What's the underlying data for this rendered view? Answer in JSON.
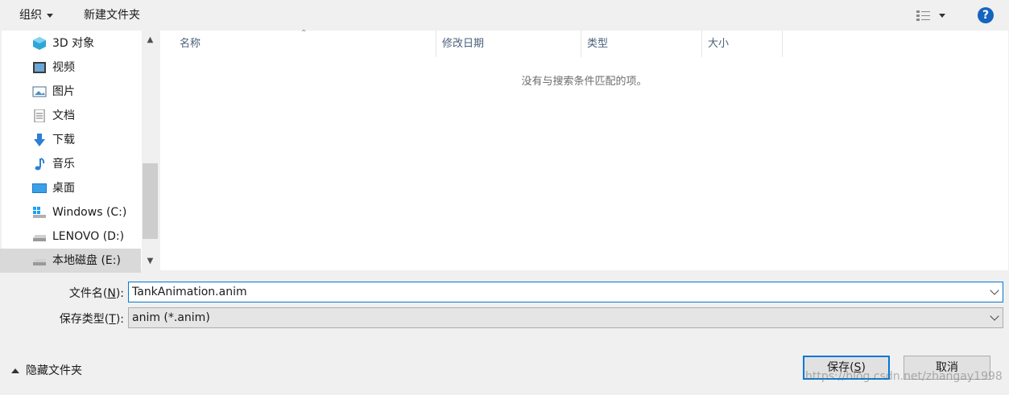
{
  "toolbar": {
    "organize_label": "组织",
    "new_folder_label": "新建文件夹",
    "help_label": "?"
  },
  "nav": {
    "items": [
      {
        "label": "3D 对象",
        "icon": "3d-objects-icon"
      },
      {
        "label": "视频",
        "icon": "video-icon"
      },
      {
        "label": "图片",
        "icon": "picture-icon"
      },
      {
        "label": "文档",
        "icon": "document-icon"
      },
      {
        "label": "下载",
        "icon": "download-icon"
      },
      {
        "label": "音乐",
        "icon": "music-icon"
      },
      {
        "label": "桌面",
        "icon": "desktop-icon"
      },
      {
        "label": "Windows (C:)",
        "icon": "windows-drive-icon"
      },
      {
        "label": "LENOVO (D:)",
        "icon": "drive-icon"
      },
      {
        "label": "本地磁盘 (E:)",
        "icon": "drive-icon",
        "selected": true
      }
    ]
  },
  "list": {
    "columns": [
      "名称",
      "修改日期",
      "类型",
      "大小"
    ],
    "empty_message": "没有与搜索条件匹配的项。"
  },
  "form": {
    "filename_label": "文件名(",
    "filename_mnemonic": "N",
    "filename_label_suffix": "):",
    "filename_value": "TankAnimation.anim",
    "savetype_label": "保存类型(",
    "savetype_mnemonic": "T",
    "savetype_label_suffix": "):",
    "savetype_value": "anim (*.anim)"
  },
  "footer": {
    "hide_folders_label": "隐藏文件夹",
    "save_label": "保存(",
    "save_mnemonic": "S",
    "save_suffix": ")",
    "cancel_label": "取消",
    "watermark": "https://blog.csdn.net/zhangay1998"
  },
  "colors": {
    "accent": "#0078d7",
    "help": "#1565c0"
  }
}
